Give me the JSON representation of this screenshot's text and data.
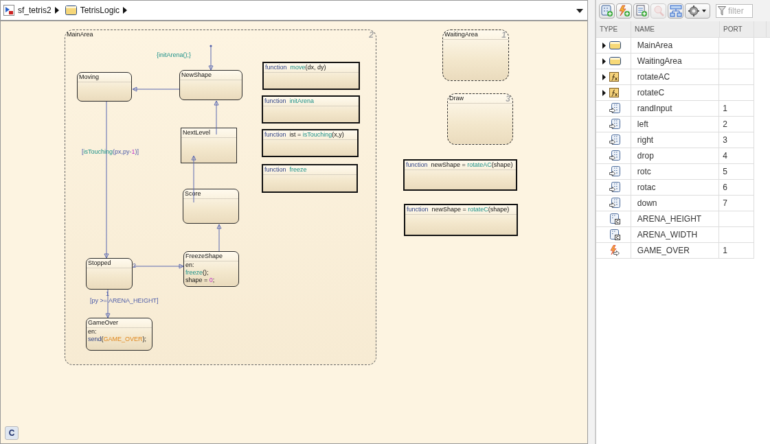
{
  "breadcrumb": [
    {
      "kind": "model",
      "label": "sf_tetris2"
    },
    {
      "kind": "chart",
      "label": "TetrisLogic"
    }
  ],
  "chart": {
    "nodes": [
      {
        "kind": "superstate",
        "name": "MainArea",
        "number": "2"
      },
      {
        "kind": "superstate",
        "name": "WaitingArea",
        "number": "1"
      },
      {
        "kind": "state",
        "name": "Moving"
      },
      {
        "kind": "state",
        "name": "NewShape"
      },
      {
        "kind": "function",
        "signature": [
          {
            "text": "function",
            "kind": "kw"
          },
          {
            "text": "  move",
            "kind": "fn"
          },
          {
            "text": "(dx, dy)",
            "kind": "plain"
          }
        ]
      },
      {
        "kind": "function",
        "signature": [
          {
            "text": "function",
            "kind": "kw"
          },
          {
            "text": "  initArena",
            "kind": "fn"
          }
        ]
      },
      {
        "kind": "box",
        "name": "NextLevel"
      },
      {
        "kind": "function",
        "signature": [
          {
            "text": "function",
            "kind": "kw"
          },
          {
            "text": "  ist = ",
            "kind": "plain"
          },
          {
            "text": "isTouching",
            "kind": "fn"
          },
          {
            "text": "(x,y)",
            "kind": "plain"
          }
        ]
      },
      {
        "kind": "superstate",
        "name": "Draw",
        "number": "3"
      },
      {
        "kind": "function",
        "signature": [
          {
            "text": "function",
            "kind": "kw"
          },
          {
            "text": "  freeze",
            "kind": "fn"
          }
        ]
      },
      {
        "kind": "function",
        "signature": [
          {
            "text": "function",
            "kind": "kw"
          },
          {
            "text": "  newShape = ",
            "kind": "plain"
          },
          {
            "text": "rotateAC",
            "kind": "fn"
          },
          {
            "text": "(shape)",
            "kind": "plain"
          }
        ]
      },
      {
        "kind": "state",
        "name": "Score"
      },
      {
        "kind": "function",
        "signature": [
          {
            "text": "function",
            "kind": "kw"
          },
          {
            "text": "  newShape = ",
            "kind": "plain"
          },
          {
            "text": "rotateC",
            "kind": "fn"
          },
          {
            "text": "(shape)",
            "kind": "plain"
          }
        ]
      },
      {
        "kind": "state",
        "name": "FreezeShape",
        "actions": [
          [
            {
              "text": "en:",
              "kind": "plain"
            }
          ],
          [
            {
              "text": "freeze",
              "kind": "fn"
            },
            {
              "text": "();",
              "kind": "plain"
            }
          ],
          [
            {
              "text": "shape = ",
              "kind": "plain"
            },
            {
              "text": "0",
              "kind": "num"
            },
            {
              "text": ";",
              "kind": "plain"
            }
          ]
        ]
      },
      {
        "kind": "state",
        "name": "Stopped"
      },
      {
        "kind": "state",
        "name": "GameOver",
        "actions": [
          [
            {
              "text": "en:",
              "kind": "plain"
            }
          ],
          [
            {
              "text": "send",
              "kind": "kw"
            },
            {
              "text": "(",
              "kind": "plain"
            },
            {
              "text": "GAME_OVER",
              "kind": "event"
            },
            {
              "text": ");",
              "kind": "plain"
            }
          ]
        ]
      }
    ],
    "transitions": [
      {
        "kind": "default",
        "label": [
          {
            "text": "{initArena();}",
            "kind": "fn"
          }
        ]
      },
      {
        "kind": "normal"
      },
      {
        "kind": "normal"
      },
      {
        "kind": "normal"
      },
      {
        "kind": "normal"
      },
      {
        "kind": "normal",
        "label": [
          {
            "text": "[",
            "kind": "plain"
          },
          {
            "text": "isTouching",
            "kind": "fn"
          },
          {
            "text": "(px,py-",
            "kind": "plain"
          },
          {
            "text": "1",
            "kind": "num"
          },
          {
            "text": ")]",
            "kind": "plain"
          }
        ]
      },
      {
        "kind": "normal",
        "order": "2"
      },
      {
        "kind": "normal",
        "order": "1",
        "label": [
          {
            "text": "[py >= ARENA_HEIGHT]",
            "kind": "plain"
          }
        ]
      }
    ],
    "badge": "C"
  },
  "panel": {
    "toolbar": [
      {
        "kind": "add-data",
        "disabled": false
      },
      {
        "kind": "add-event",
        "disabled": false
      },
      {
        "kind": "add-message",
        "disabled": false
      },
      {
        "kind": "zoom",
        "disabled": true
      },
      {
        "kind": "hierarchy",
        "disabled": false
      },
      {
        "kind": "settings",
        "disabled": false
      }
    ],
    "filter": {
      "placeholder": "filter"
    },
    "columns": [
      "TYPE",
      "NAME",
      "PORT"
    ],
    "rows": [
      {
        "kind": "state",
        "has_children": true,
        "name": "MainArea"
      },
      {
        "kind": "state",
        "has_children": true,
        "name": "WaitingArea"
      },
      {
        "kind": "function",
        "has_children": true,
        "name": "rotateAC"
      },
      {
        "kind": "function",
        "has_children": true,
        "name": "rotateC"
      },
      {
        "kind": "input",
        "has_children": false,
        "name": "randInput",
        "port": "1"
      },
      {
        "kind": "input",
        "has_children": false,
        "name": "left",
        "port": "2"
      },
      {
        "kind": "input",
        "has_children": false,
        "name": "right",
        "port": "3"
      },
      {
        "kind": "input",
        "has_children": false,
        "name": "drop",
        "port": "4"
      },
      {
        "kind": "input",
        "has_children": false,
        "name": "rotc",
        "port": "5"
      },
      {
        "kind": "input",
        "has_children": false,
        "name": "rotac",
        "port": "6"
      },
      {
        "kind": "input",
        "has_children": false,
        "name": "down",
        "port": "7"
      },
      {
        "kind": "constant",
        "has_children": false,
        "name": "ARENA_HEIGHT"
      },
      {
        "kind": "constant",
        "has_children": false,
        "name": "ARENA_WIDTH"
      },
      {
        "kind": "event",
        "has_children": false,
        "name": "GAME_OVER",
        "port": "1"
      }
    ]
  }
}
